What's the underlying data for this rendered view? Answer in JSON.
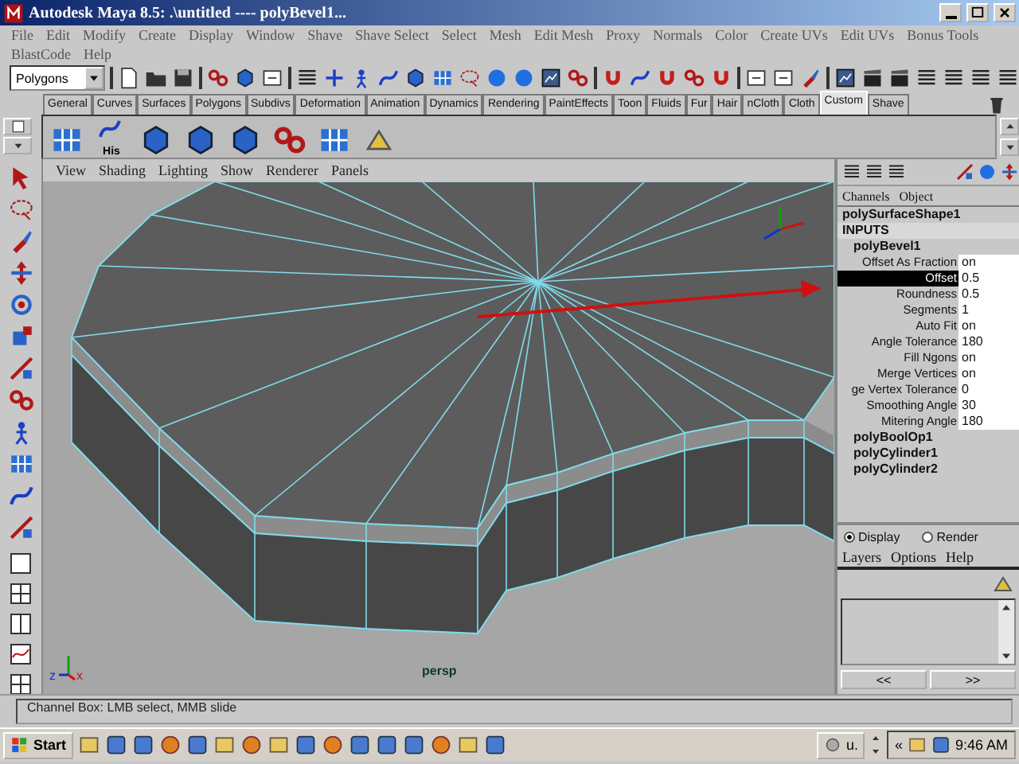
{
  "window": {
    "title": "Autodesk Maya 8.5: .\\untitled ---- polyBevel1..."
  },
  "menu_bar": [
    "File",
    "Edit",
    "Modify",
    "Create",
    "Display",
    "Window",
    "Shave",
    "Shave Select",
    "Select",
    "Mesh",
    "Edit Mesh",
    "Proxy",
    "Normals",
    "Color",
    "Create UVs",
    "Edit UVs",
    "Bonus Tools",
    "BlastCode",
    "Help"
  ],
  "status_line": {
    "mode": "Polygons"
  },
  "shelf": {
    "tabs": [
      {
        "label": "General",
        "selected": false
      },
      {
        "label": "Curves",
        "selected": false
      },
      {
        "label": "Surfaces",
        "selected": false
      },
      {
        "label": "Polygons",
        "selected": false
      },
      {
        "label": "Subdivs",
        "selected": false
      },
      {
        "label": "Deformation",
        "selected": false
      },
      {
        "label": "Animation",
        "selected": false
      },
      {
        "label": "Dynamics",
        "selected": false
      },
      {
        "label": "Rendering",
        "selected": false
      },
      {
        "label": "PaintEffects",
        "selected": false
      },
      {
        "label": "Toon",
        "selected": false
      },
      {
        "label": "Fluids",
        "selected": false
      },
      {
        "label": "Fur",
        "selected": false
      },
      {
        "label": "Hair",
        "selected": false
      },
      {
        "label": "nCloth",
        "selected": false
      },
      {
        "label": "Cloth",
        "selected": false
      },
      {
        "label": "Custom",
        "selected": true
      },
      {
        "label": "Shave",
        "selected": false
      }
    ],
    "history_label": "His"
  },
  "viewport": {
    "menus": [
      "View",
      "Shading",
      "Lighting",
      "Show",
      "Renderer",
      "Panels"
    ],
    "camera": "persp",
    "axis_labels": [
      "z",
      "x"
    ]
  },
  "channel_box": {
    "menus": [
      "Channels",
      "Object"
    ],
    "shape": "polySurfaceShape1",
    "inputs_header": "INPUTS",
    "nodes": [
      {
        "name": "polyBevel1",
        "attributes": [
          {
            "name": "Offset As Fraction",
            "value": "on",
            "selected": false
          },
          {
            "name": "Offset",
            "value": "0.5",
            "selected": true
          },
          {
            "name": "Roundness",
            "value": "0.5",
            "selected": false
          },
          {
            "name": "Segments",
            "value": "1",
            "selected": false
          },
          {
            "name": "Auto Fit",
            "value": "on",
            "selected": false
          },
          {
            "name": "Angle Tolerance",
            "value": "180",
            "selected": false
          },
          {
            "name": "Fill Ngons",
            "value": "on",
            "selected": false
          },
          {
            "name": "Merge Vertices",
            "value": "on",
            "selected": false
          },
          {
            "name": "ge Vertex Tolerance",
            "value": "0",
            "selected": false
          },
          {
            "name": "Smoothing Angle",
            "value": "30",
            "selected": false
          },
          {
            "name": "Mitering Angle",
            "value": "180",
            "selected": false
          }
        ]
      },
      {
        "name": "polyBoolOp1"
      },
      {
        "name": "polyCylinder1"
      },
      {
        "name": "polyCylinder2"
      }
    ]
  },
  "layer_editor": {
    "modes": [
      {
        "label": "Display",
        "selected": true
      },
      {
        "label": "Render",
        "selected": false
      }
    ],
    "menus": [
      "Layers",
      "Options",
      "Help"
    ],
    "buttons": [
      "<<",
      ">>"
    ]
  },
  "help_line": "Channel Box: LMB select, MMB slide",
  "taskbar": {
    "start": "Start",
    "task": "u.",
    "tray_expand": "«",
    "clock": "9:46 AM"
  }
}
